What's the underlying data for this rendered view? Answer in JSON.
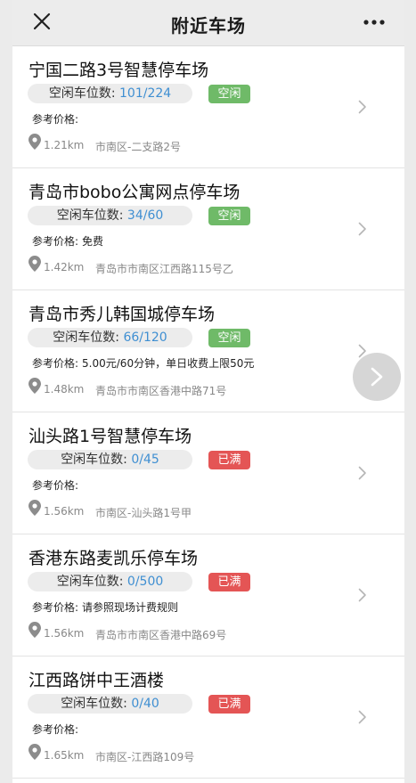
{
  "header": {
    "title": "附近车场",
    "close_icon": "close-icon",
    "more_icon": "more-dots-icon"
  },
  "colors": {
    "free_badge": "#6fba68",
    "full_badge": "#e45555",
    "count_text": "#3f8fd2",
    "header_bg": "#ececec"
  },
  "lots": [
    {
      "name": "宁国二路3号智慧停车场",
      "spaces_label": "空闲车位数: ",
      "spaces_value": "101/224",
      "status": "空闲",
      "status_type": "free",
      "price_label": "参考价格:",
      "price_value": "",
      "distance": "1.21km",
      "address": "市南区-二支路2号"
    },
    {
      "name": "青岛市bobo公寓网点停车场",
      "spaces_label": "空闲车位数: ",
      "spaces_value": "34/60",
      "status": "空闲",
      "status_type": "free",
      "price_label": "参考价格:",
      "price_value": "免费",
      "distance": "1.42km",
      "address": "青岛市市南区江西路115号乙"
    },
    {
      "name": "青岛市秀儿韩国城停车场",
      "spaces_label": "空闲车位数: ",
      "spaces_value": "66/120",
      "status": "空闲",
      "status_type": "free",
      "price_label": "参考价格:",
      "price_value": "5.00元/60分钟，单日收费上限50元",
      "distance": "1.48km",
      "address": "青岛市市南区香港中路71号"
    },
    {
      "name": "汕头路1号智慧停车场",
      "spaces_label": "空闲车位数: ",
      "spaces_value": "0/45",
      "status": "已满",
      "status_type": "full",
      "price_label": "参考价格:",
      "price_value": "",
      "distance": "1.56km",
      "address": "市南区-汕头路1号甲"
    },
    {
      "name": "香港东路麦凯乐停车场",
      "spaces_label": "空闲车位数: ",
      "spaces_value": "0/500",
      "status": "已满",
      "status_type": "full",
      "price_label": "参考价格:",
      "price_value": "请参照现场计费规则",
      "distance": "1.56km",
      "address": "青岛市市南区香港中路69号"
    },
    {
      "name": "江西路饼中王酒楼",
      "spaces_label": "空闲车位数: ",
      "spaces_value": "0/40",
      "status": "已满",
      "status_type": "full",
      "price_label": "参考价格:",
      "price_value": "",
      "distance": "1.65km",
      "address": "市南区-江西路109号"
    }
  ]
}
